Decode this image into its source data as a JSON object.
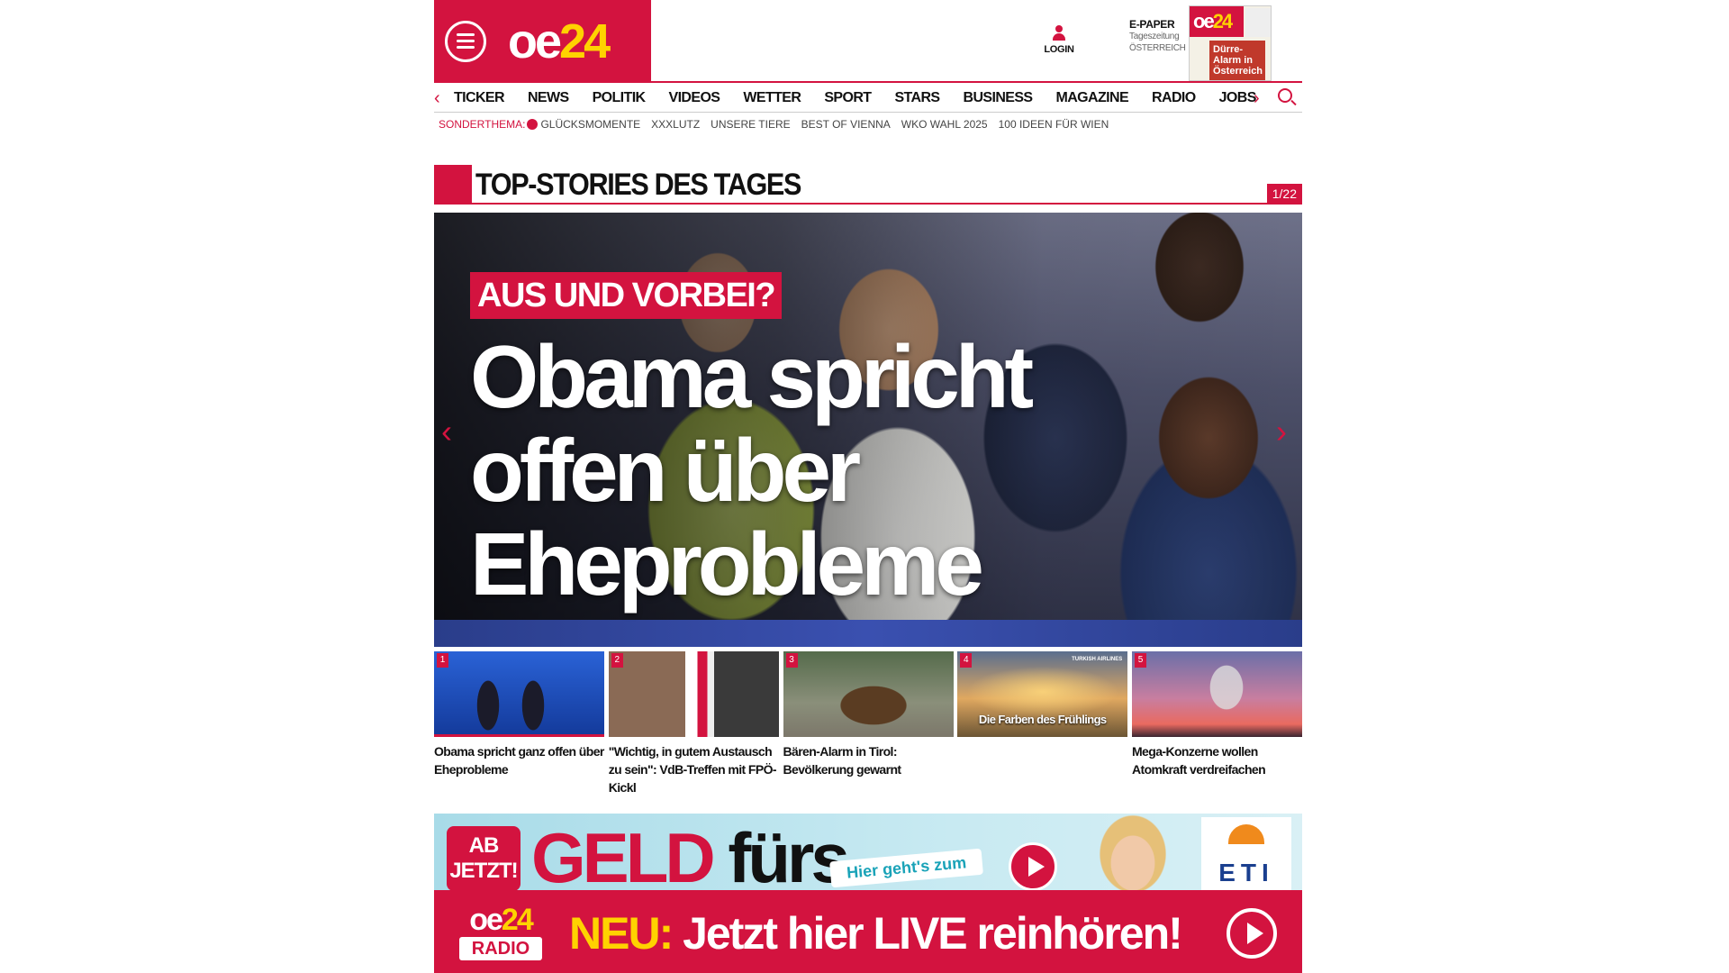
{
  "header": {
    "logo_main": "oe",
    "logo_accent": "24",
    "login_label": "LOGIN",
    "epaper_title": "E-PAPER",
    "epaper_line1": "Tageszeitung",
    "epaper_line2": "ÖSTERREICH",
    "epaper_cover_headline": "Dürre-Alarm in Österreich"
  },
  "nav": {
    "items": [
      "TICKER",
      "NEWS",
      "POLITIK",
      "VIDEOS",
      "WETTER",
      "SPORT",
      "STARS",
      "BUSINESS",
      "MAGAZINE",
      "RADIO",
      "JOBS"
    ]
  },
  "subnav": {
    "label": "SONDERTHEMA:",
    "items": [
      "GLÜCKSMOMENTE",
      "XXXLUTZ",
      "UNSERE TIERE",
      "BEST OF VIENNA",
      "WKO WAHL 2025",
      "100 IDEEN FÜR WIEN"
    ]
  },
  "section": {
    "title": "TOP-STORIES DES TAGES",
    "pager": "1/22"
  },
  "hero": {
    "kicker": "AUS UND VORBEI?",
    "headline": "Obama spricht offen über Eheprobleme"
  },
  "thumbs": [
    {
      "num": "1",
      "caption": "Obama spricht ganz offen über Eheprobleme"
    },
    {
      "num": "2",
      "caption": "\"Wichtig, in gutem Austausch zu sein\": VdB-Treffen mit FPÖ-Kickl"
    },
    {
      "num": "3",
      "caption": "Bären-Alarm in Tirol: Bevölkerung gewarnt"
    },
    {
      "num": "4",
      "caption": "",
      "overlay": "Die Farben des Frühlings",
      "brand": "TURKISH AIRLINES"
    },
    {
      "num": "5",
      "caption": "Mega-Konzerne wollen Atomkraft verdreifachen"
    }
  ],
  "ad": {
    "badge": "AB JETZT!",
    "big_red": "GELD",
    "big_black": "fürs",
    "tag": "Hier geht's zum",
    "brand": "ETI"
  },
  "radio": {
    "logo_main": "oe",
    "logo_accent": "24",
    "logo_sub": "RADIO",
    "new_label": "NEU:",
    "message": "Jetzt hier LIVE reinhören!"
  },
  "colors": {
    "brand_red": "#d3133f",
    "accent_yellow": "#ffd200"
  }
}
